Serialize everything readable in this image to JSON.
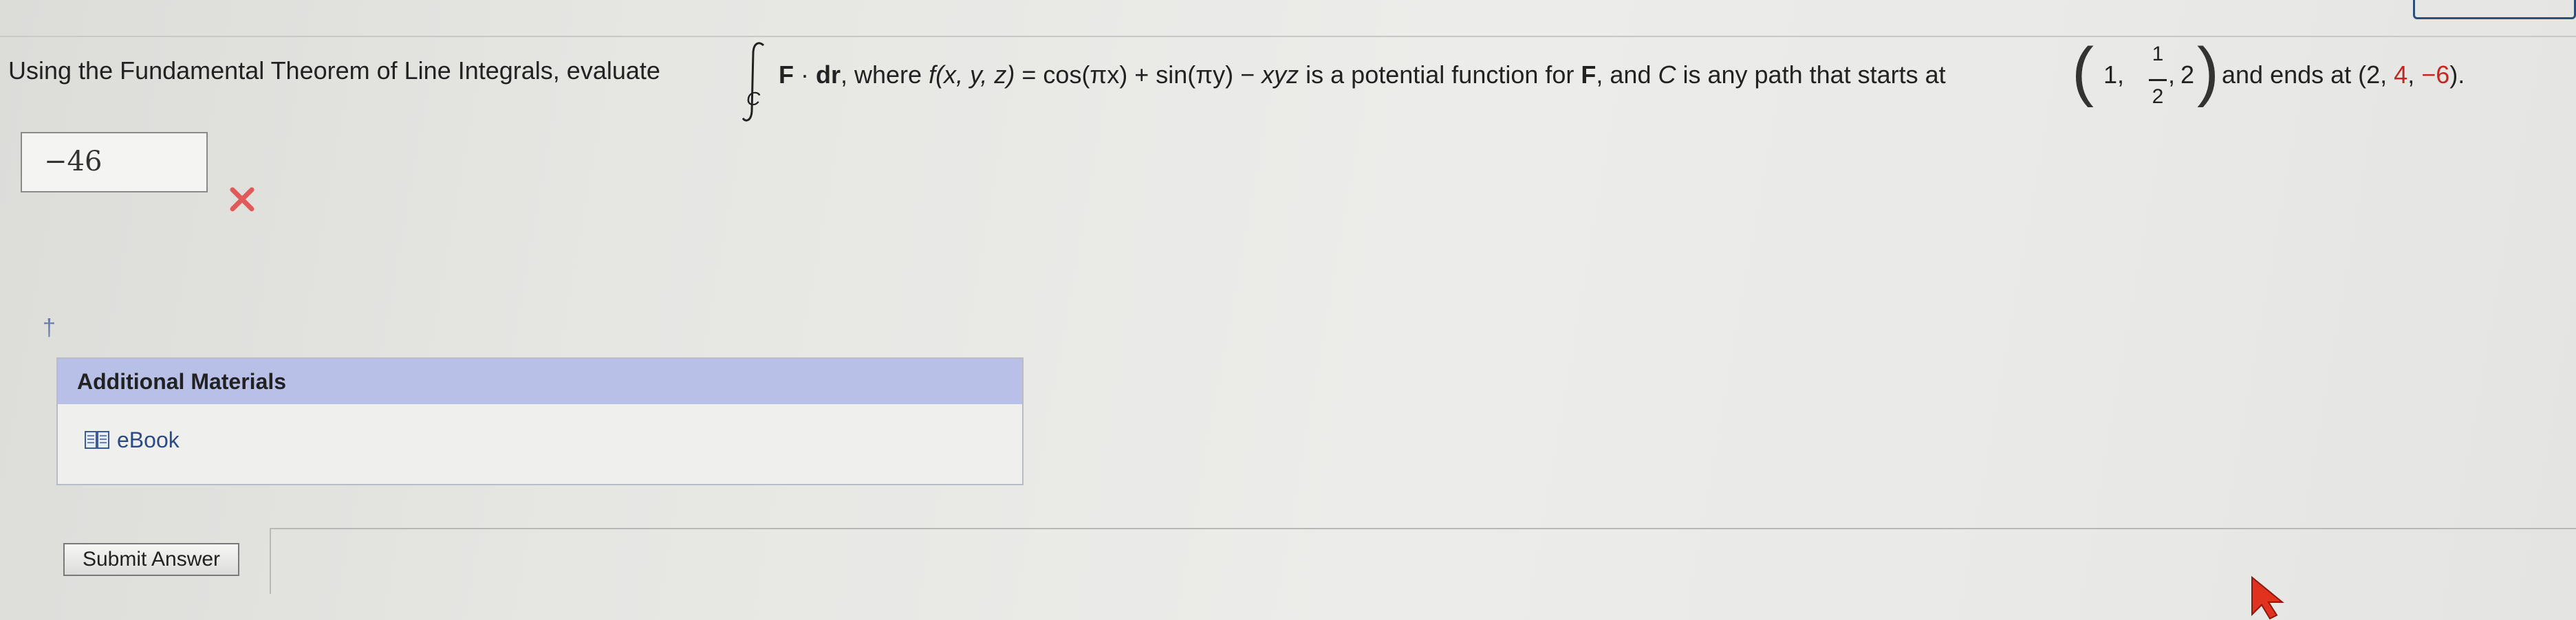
{
  "question": {
    "intro": "Using the Fundamental Theorem of Line Integrals, evaluate",
    "integral_subscript": "C",
    "f_bold": "F",
    "dot": " · ",
    "dr": "dr",
    "where": ", where ",
    "fxyz": "f(x, y, z)",
    "equals_expr": " = cos(πx) + sin(πy) − ",
    "xyz": "xyz",
    "is_potential": " is a potential function for ",
    "f_bold2": "F",
    "and_c": ", and ",
    "c_italic": "C",
    "path_text": " is any path that starts at ",
    "start_x": "1,",
    "start_y_num": "1",
    "start_y_den": "2",
    "start_y_comma": ",",
    "start_z": "2",
    "ends_text": "and ends at (2, ",
    "end_y": "4",
    "end_sep": ", ",
    "end_z": "−6",
    "end_close": ")."
  },
  "answer": {
    "value": "−46",
    "status": "incorrect"
  },
  "dagger": "†",
  "materials": {
    "header": "Additional Materials",
    "ebook_label": "eBook"
  },
  "submit_label": "Submit Answer",
  "colors": {
    "accent_red": "#c4271f",
    "header_bg": "#b8c0e8",
    "link": "#2c4b86",
    "wrong": "#e05a5a"
  },
  "icons": {
    "wrong": "x-mark-icon",
    "ebook": "book-icon",
    "cursor": "cursor-icon"
  }
}
